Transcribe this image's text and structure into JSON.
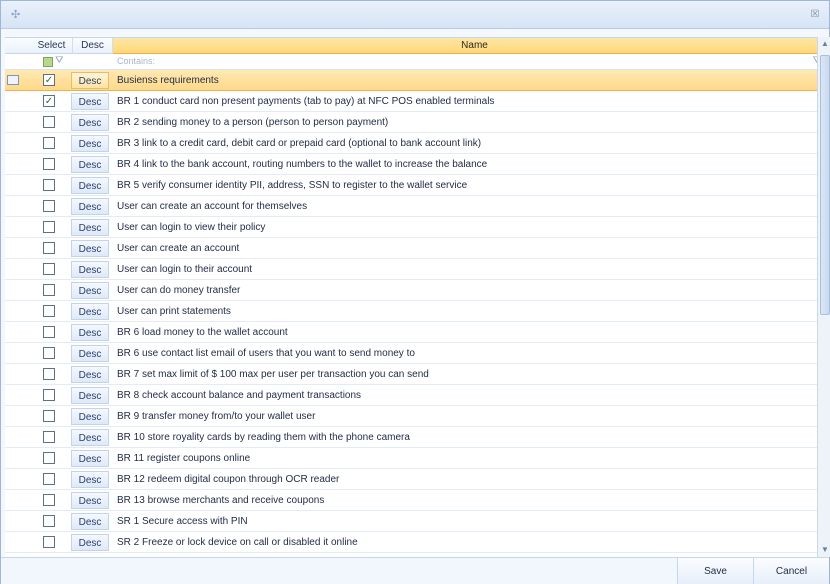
{
  "window": {
    "title_icon": "grip-icon",
    "close_icon": "close-icon"
  },
  "grid": {
    "columns": {
      "select": "Select",
      "desc": "Desc",
      "name": "Name"
    },
    "filter": {
      "placeholder": "Contains:"
    },
    "rows": [
      {
        "checked": true,
        "desc": "Desc",
        "name": "Busienss requirements",
        "selected": true
      },
      {
        "checked": true,
        "desc": "Desc",
        "name": "BR 1 conduct card non present payments (tab to pay) at NFC POS enabled terminals"
      },
      {
        "checked": false,
        "desc": "Desc",
        "name": "BR 2 sending money to a person (person to person payment)"
      },
      {
        "checked": false,
        "desc": "Desc",
        "name": "BR 3 link to a credit card, debit card or prepaid card (optional to bank account link)"
      },
      {
        "checked": false,
        "desc": "Desc",
        "name": "BR 4 link to the bank account, routing numbers to the wallet to increase the balance"
      },
      {
        "checked": false,
        "desc": "Desc",
        "name": "BR 5 verify consumer identity PII, address, SSN to register to the wallet service"
      },
      {
        "checked": false,
        "desc": "Desc",
        "name": "User can create an account for themselves"
      },
      {
        "checked": false,
        "desc": "Desc",
        "name": "User can login to view their policy"
      },
      {
        "checked": false,
        "desc": "Desc",
        "name": "User can create an account"
      },
      {
        "checked": false,
        "desc": "Desc",
        "name": "User can login to their account"
      },
      {
        "checked": false,
        "desc": "Desc",
        "name": "User can do money transfer"
      },
      {
        "checked": false,
        "desc": "Desc",
        "name": "User can print statements"
      },
      {
        "checked": false,
        "desc": "Desc",
        "name": "BR 6 load money to the wallet account"
      },
      {
        "checked": false,
        "desc": "Desc",
        "name": "BR 6 use contact list email of users that you want to send money to"
      },
      {
        "checked": false,
        "desc": "Desc",
        "name": "BR 7 set max limit of $ 100 max per user per transaction you can send"
      },
      {
        "checked": false,
        "desc": "Desc",
        "name": "BR 8 check account balance and payment transactions"
      },
      {
        "checked": false,
        "desc": "Desc",
        "name": "BR 9 transfer money from/to your wallet user"
      },
      {
        "checked": false,
        "desc": "Desc",
        "name": "BR 10 store royality cards by reading them with the phone camera"
      },
      {
        "checked": false,
        "desc": "Desc",
        "name": "BR 11 register coupons online"
      },
      {
        "checked": false,
        "desc": "Desc",
        "name": "BR 12 redeem digital coupon through OCR reader"
      },
      {
        "checked": false,
        "desc": "Desc",
        "name": "BR 13 browse merchants and receive coupons"
      },
      {
        "checked": false,
        "desc": "Desc",
        "name": "SR 1 Secure access with PIN"
      },
      {
        "checked": false,
        "desc": "Desc",
        "name": "SR 2 Freeze or lock device on call or disabled it online"
      }
    ]
  },
  "footer": {
    "save_label": "Save",
    "cancel_label": "Cancel"
  },
  "colors": {
    "selected_row": "#ffd98a",
    "header_active": "#ffd777",
    "accent_blue": "#c6d6ec"
  }
}
